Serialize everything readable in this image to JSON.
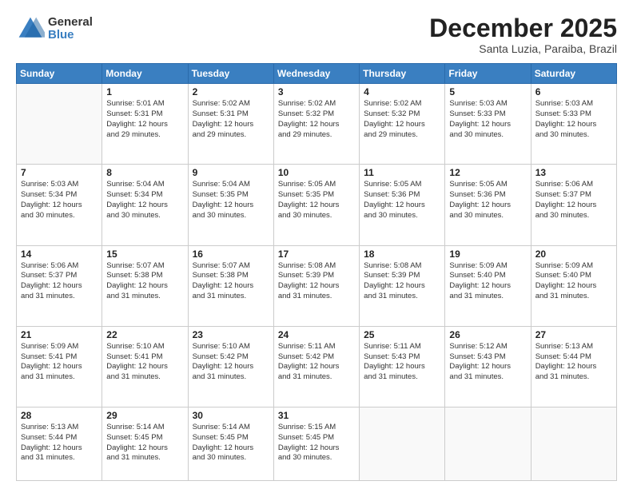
{
  "logo": {
    "general": "General",
    "blue": "Blue"
  },
  "header": {
    "month": "December 2025",
    "location": "Santa Luzia, Paraiba, Brazil"
  },
  "days_of_week": [
    "Sunday",
    "Monday",
    "Tuesday",
    "Wednesday",
    "Thursday",
    "Friday",
    "Saturday"
  ],
  "weeks": [
    [
      {
        "day": "",
        "info": ""
      },
      {
        "day": "1",
        "info": "Sunrise: 5:01 AM\nSunset: 5:31 PM\nDaylight: 12 hours\nand 29 minutes."
      },
      {
        "day": "2",
        "info": "Sunrise: 5:02 AM\nSunset: 5:31 PM\nDaylight: 12 hours\nand 29 minutes."
      },
      {
        "day": "3",
        "info": "Sunrise: 5:02 AM\nSunset: 5:32 PM\nDaylight: 12 hours\nand 29 minutes."
      },
      {
        "day": "4",
        "info": "Sunrise: 5:02 AM\nSunset: 5:32 PM\nDaylight: 12 hours\nand 29 minutes."
      },
      {
        "day": "5",
        "info": "Sunrise: 5:03 AM\nSunset: 5:33 PM\nDaylight: 12 hours\nand 30 minutes."
      },
      {
        "day": "6",
        "info": "Sunrise: 5:03 AM\nSunset: 5:33 PM\nDaylight: 12 hours\nand 30 minutes."
      }
    ],
    [
      {
        "day": "7",
        "info": "Sunrise: 5:03 AM\nSunset: 5:34 PM\nDaylight: 12 hours\nand 30 minutes."
      },
      {
        "day": "8",
        "info": "Sunrise: 5:04 AM\nSunset: 5:34 PM\nDaylight: 12 hours\nand 30 minutes."
      },
      {
        "day": "9",
        "info": "Sunrise: 5:04 AM\nSunset: 5:35 PM\nDaylight: 12 hours\nand 30 minutes."
      },
      {
        "day": "10",
        "info": "Sunrise: 5:05 AM\nSunset: 5:35 PM\nDaylight: 12 hours\nand 30 minutes."
      },
      {
        "day": "11",
        "info": "Sunrise: 5:05 AM\nSunset: 5:36 PM\nDaylight: 12 hours\nand 30 minutes."
      },
      {
        "day": "12",
        "info": "Sunrise: 5:05 AM\nSunset: 5:36 PM\nDaylight: 12 hours\nand 30 minutes."
      },
      {
        "day": "13",
        "info": "Sunrise: 5:06 AM\nSunset: 5:37 PM\nDaylight: 12 hours\nand 30 minutes."
      }
    ],
    [
      {
        "day": "14",
        "info": "Sunrise: 5:06 AM\nSunset: 5:37 PM\nDaylight: 12 hours\nand 31 minutes."
      },
      {
        "day": "15",
        "info": "Sunrise: 5:07 AM\nSunset: 5:38 PM\nDaylight: 12 hours\nand 31 minutes."
      },
      {
        "day": "16",
        "info": "Sunrise: 5:07 AM\nSunset: 5:38 PM\nDaylight: 12 hours\nand 31 minutes."
      },
      {
        "day": "17",
        "info": "Sunrise: 5:08 AM\nSunset: 5:39 PM\nDaylight: 12 hours\nand 31 minutes."
      },
      {
        "day": "18",
        "info": "Sunrise: 5:08 AM\nSunset: 5:39 PM\nDaylight: 12 hours\nand 31 minutes."
      },
      {
        "day": "19",
        "info": "Sunrise: 5:09 AM\nSunset: 5:40 PM\nDaylight: 12 hours\nand 31 minutes."
      },
      {
        "day": "20",
        "info": "Sunrise: 5:09 AM\nSunset: 5:40 PM\nDaylight: 12 hours\nand 31 minutes."
      }
    ],
    [
      {
        "day": "21",
        "info": "Sunrise: 5:09 AM\nSunset: 5:41 PM\nDaylight: 12 hours\nand 31 minutes."
      },
      {
        "day": "22",
        "info": "Sunrise: 5:10 AM\nSunset: 5:41 PM\nDaylight: 12 hours\nand 31 minutes."
      },
      {
        "day": "23",
        "info": "Sunrise: 5:10 AM\nSunset: 5:42 PM\nDaylight: 12 hours\nand 31 minutes."
      },
      {
        "day": "24",
        "info": "Sunrise: 5:11 AM\nSunset: 5:42 PM\nDaylight: 12 hours\nand 31 minutes."
      },
      {
        "day": "25",
        "info": "Sunrise: 5:11 AM\nSunset: 5:43 PM\nDaylight: 12 hours\nand 31 minutes."
      },
      {
        "day": "26",
        "info": "Sunrise: 5:12 AM\nSunset: 5:43 PM\nDaylight: 12 hours\nand 31 minutes."
      },
      {
        "day": "27",
        "info": "Sunrise: 5:13 AM\nSunset: 5:44 PM\nDaylight: 12 hours\nand 31 minutes."
      }
    ],
    [
      {
        "day": "28",
        "info": "Sunrise: 5:13 AM\nSunset: 5:44 PM\nDaylight: 12 hours\nand 31 minutes."
      },
      {
        "day": "29",
        "info": "Sunrise: 5:14 AM\nSunset: 5:45 PM\nDaylight: 12 hours\nand 31 minutes."
      },
      {
        "day": "30",
        "info": "Sunrise: 5:14 AM\nSunset: 5:45 PM\nDaylight: 12 hours\nand 30 minutes."
      },
      {
        "day": "31",
        "info": "Sunrise: 5:15 AM\nSunset: 5:45 PM\nDaylight: 12 hours\nand 30 minutes."
      },
      {
        "day": "",
        "info": ""
      },
      {
        "day": "",
        "info": ""
      },
      {
        "day": "",
        "info": ""
      }
    ]
  ]
}
